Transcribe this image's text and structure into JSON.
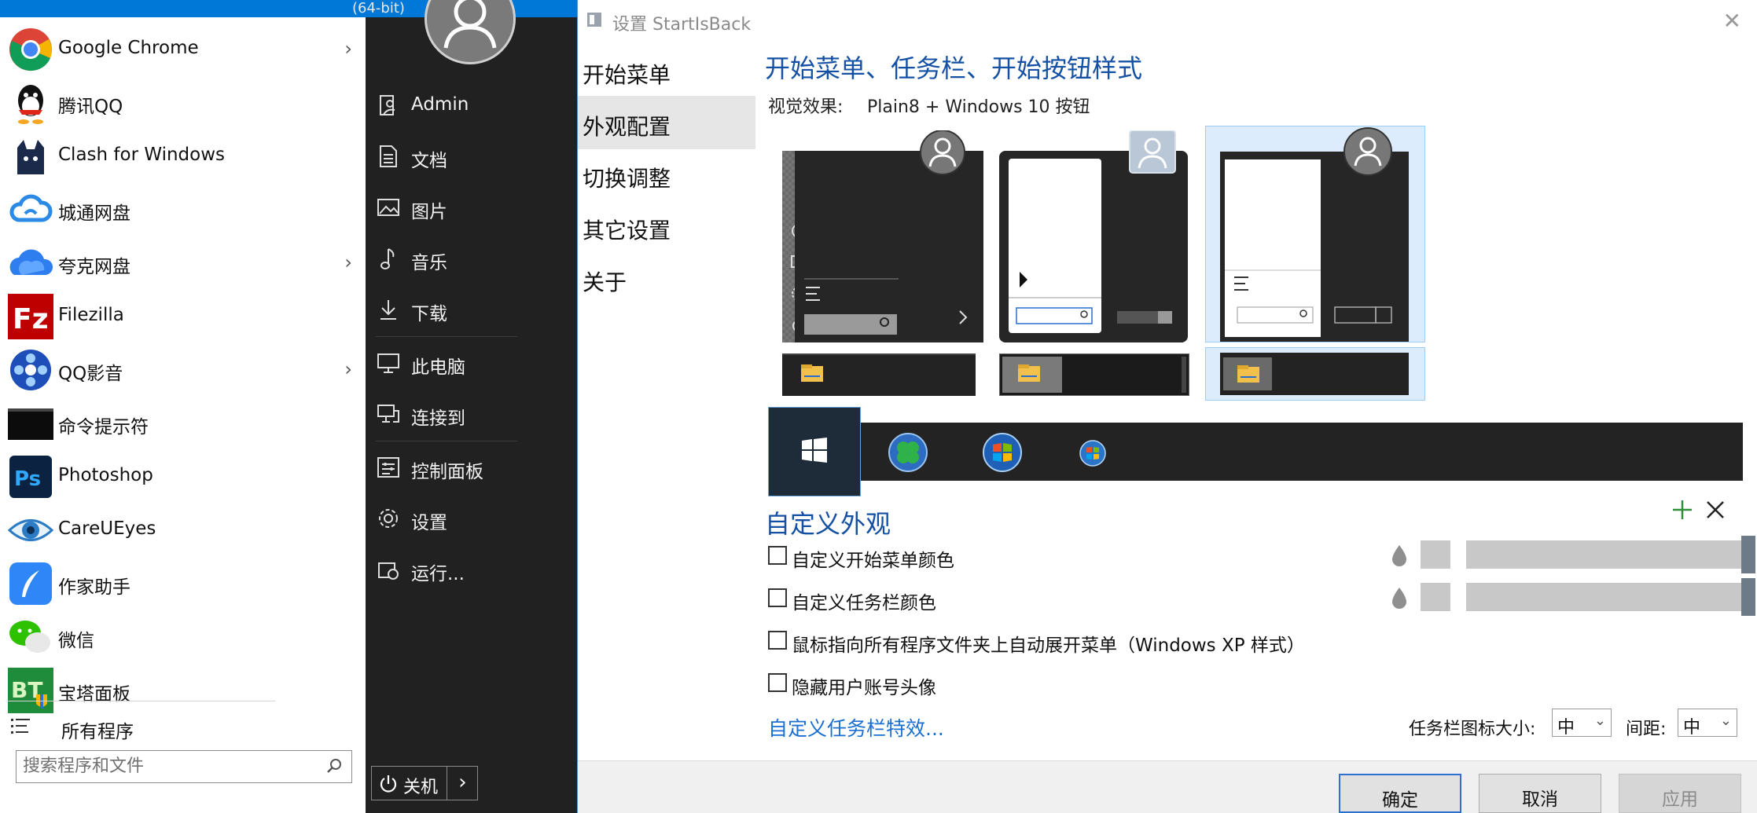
{
  "top_strip": {
    "text": "(64-bit)"
  },
  "start_menu": {
    "programs": [
      {
        "label": "Google Chrome",
        "icon": "chrome-icon",
        "has_submenu": true
      },
      {
        "label": "腾讯QQ",
        "icon": "qq-icon",
        "has_submenu": false
      },
      {
        "label": "Clash for Windows",
        "icon": "clash-icon",
        "has_submenu": false
      },
      {
        "label": "城通网盘",
        "icon": "cloud-drive-icon",
        "has_submenu": false
      },
      {
        "label": "夸克网盘",
        "icon": "quark-drive-icon",
        "has_submenu": true
      },
      {
        "label": "Filezilla",
        "icon": "filezilla-icon",
        "has_submenu": false
      },
      {
        "label": "QQ影音",
        "icon": "qq-video-icon",
        "has_submenu": true
      },
      {
        "label": "命令提示符",
        "icon": "cmd-icon",
        "has_submenu": false
      },
      {
        "label": "Photoshop",
        "icon": "photoshop-icon",
        "has_submenu": false
      },
      {
        "label": "CareUEyes",
        "icon": "careueyes-icon",
        "has_submenu": false
      },
      {
        "label": "作家助手",
        "icon": "writer-assistant-icon",
        "has_submenu": false
      },
      {
        "label": "微信",
        "icon": "wechat-icon",
        "has_submenu": false
      },
      {
        "label": "宝塔面板",
        "icon": "bt-panel-icon",
        "has_submenu": false
      }
    ],
    "all_programs": "所有程序",
    "search_placeholder": "搜索程序和文件",
    "right_links": [
      {
        "label": "Admin",
        "icon": "user-folder-icon"
      },
      {
        "label": "文档",
        "icon": "document-icon"
      },
      {
        "label": "图片",
        "icon": "picture-icon"
      },
      {
        "label": "音乐",
        "icon": "music-icon"
      },
      {
        "label": "下载",
        "icon": "download-icon"
      },
      {
        "label": "此电脑",
        "icon": "computer-icon"
      },
      {
        "label": "连接到",
        "icon": "connect-icon"
      },
      {
        "label": "控制面板",
        "icon": "control-panel-icon"
      },
      {
        "label": "设置",
        "icon": "settings-icon"
      },
      {
        "label": "运行...",
        "icon": "run-icon"
      }
    ],
    "power_label": "关机"
  },
  "dialog": {
    "title": "设置 StartIsBack",
    "nav": [
      {
        "label": "开始菜单",
        "selected": false
      },
      {
        "label": "外观配置",
        "selected": true
      },
      {
        "label": "切换调整",
        "selected": false
      },
      {
        "label": "其它设置",
        "selected": false
      },
      {
        "label": "关于",
        "selected": false
      }
    ],
    "section1_title": "开始菜单、任务栏、开始按钮样式",
    "visual_label": "视觉效果:",
    "visual_value": "Plain8 + Windows 10 按钮",
    "section2_title": "自定义外观",
    "options": [
      {
        "label": "自定义开始菜单颜色",
        "checked": false
      },
      {
        "label": "自定义任务栏颜色",
        "checked": false
      },
      {
        "label": "鼠标指向所有程序文件夹上自动展开菜单（Windows XP 样式）",
        "checked": false
      },
      {
        "label": "隐藏用户账号头像",
        "checked": false
      }
    ],
    "custom_taskbar_link": "自定义任务栏特效...",
    "icon_size_label": "任务栏图标大小:",
    "icon_size_value": "中",
    "spacing_label": "间距:",
    "spacing_value": "中",
    "buttons": {
      "ok": "确定",
      "cancel": "取消",
      "apply": "应用"
    }
  },
  "colors": {
    "accent": "#1450a3",
    "link": "#1a6fd1",
    "menu_dark": "#212121",
    "selection": "#dcecfc"
  }
}
